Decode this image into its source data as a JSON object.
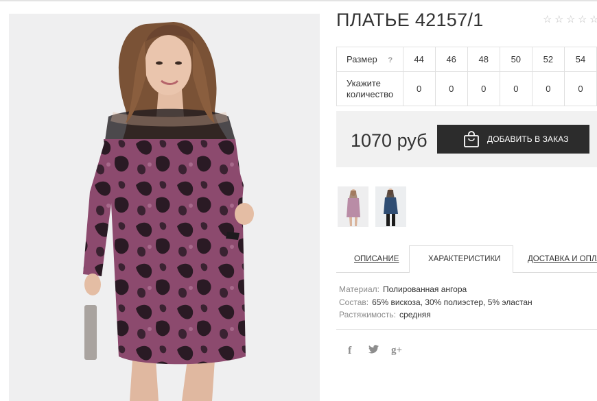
{
  "product": {
    "title": "ПЛАТЬЕ 42157/1",
    "rating_stars": 5,
    "rating_filled": 0
  },
  "sizes": {
    "size_label": "Размер",
    "help_mark": "?",
    "qty_label_1": "Укажите",
    "qty_label_2": "количество",
    "items": [
      {
        "size": "44",
        "qty": "0"
      },
      {
        "size": "46",
        "qty": "0"
      },
      {
        "size": "48",
        "qty": "0"
      },
      {
        "size": "50",
        "qty": "0"
      },
      {
        "size": "52",
        "qty": "0"
      },
      {
        "size": "54",
        "qty": "0"
      }
    ]
  },
  "purchase": {
    "price": "1070 руб",
    "order_button_label": "ДОБАВИТЬ В ЗАКАЗ",
    "order_icon": "shopping-bag-icon"
  },
  "thumbnails": [
    {
      "name": "thumb-pink-dress",
      "color": "#b98ca6"
    },
    {
      "name": "thumb-blue-dress",
      "color": "#2f4d73"
    }
  ],
  "tabs": {
    "description": "ОПИСАНИЕ",
    "characteristics": "ХАРАКТЕРИСТИКИ",
    "delivery": "ДОСТАВКА И ОПЛАТА"
  },
  "characteristics": [
    {
      "key": "Материал:",
      "value": "Полированная ангора"
    },
    {
      "key": "Состав:",
      "value": "65% вискоза, 30% полиэстер, 5% эластан"
    },
    {
      "key": "Растяжимость:",
      "value": "средняя"
    }
  ],
  "social": {
    "facebook": "f",
    "twitter": "twitter-icon",
    "googleplus": "g+"
  },
  "colors": {
    "button_bg": "#2c2c2c",
    "price_box_bg": "#f1f1f1",
    "dress_main": "#8c4a6e",
    "dress_dark": "#2a1a24"
  }
}
